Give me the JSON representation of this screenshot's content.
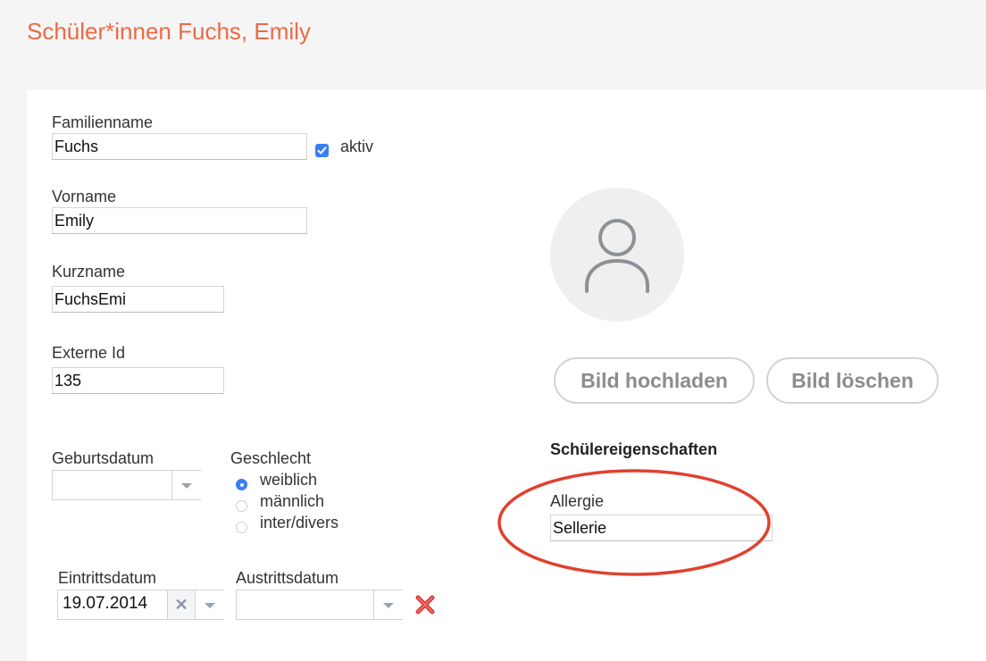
{
  "header": {
    "title": "Schüler*innen Fuchs, Emily"
  },
  "form": {
    "familienname": {
      "label": "Familienname",
      "value": "Fuchs"
    },
    "aktiv": {
      "label": "aktiv",
      "checked": true
    },
    "vorname": {
      "label": "Vorname",
      "value": "Emily"
    },
    "kurzname": {
      "label": "Kurzname",
      "value": "FuchsEmi"
    },
    "externe_id": {
      "label": "Externe Id",
      "value": "135"
    },
    "geburtsdatum": {
      "label": "Geburtsdatum",
      "value": ""
    },
    "geschlecht": {
      "label": "Geschlecht",
      "options": [
        "weiblich",
        "männlich",
        "inter/divers"
      ],
      "selected": "weiblich"
    },
    "eintrittsdatum": {
      "label": "Eintrittsdatum",
      "value": "19.07.2014"
    },
    "austrittsdatum": {
      "label": "Austrittsdatum",
      "value": ""
    }
  },
  "photo": {
    "avatar_icon": "user-silhouette-icon",
    "upload_label": "Bild hochladen",
    "delete_label": "Bild löschen"
  },
  "properties": {
    "title": "Schülereigenschaften",
    "allergie": {
      "label": "Allergie",
      "value": "Sellerie"
    }
  },
  "colors": {
    "title": "#ec6a45",
    "accent": "#3a7ff2",
    "annotation": "#e0412f",
    "delete": "#d83a3a"
  }
}
